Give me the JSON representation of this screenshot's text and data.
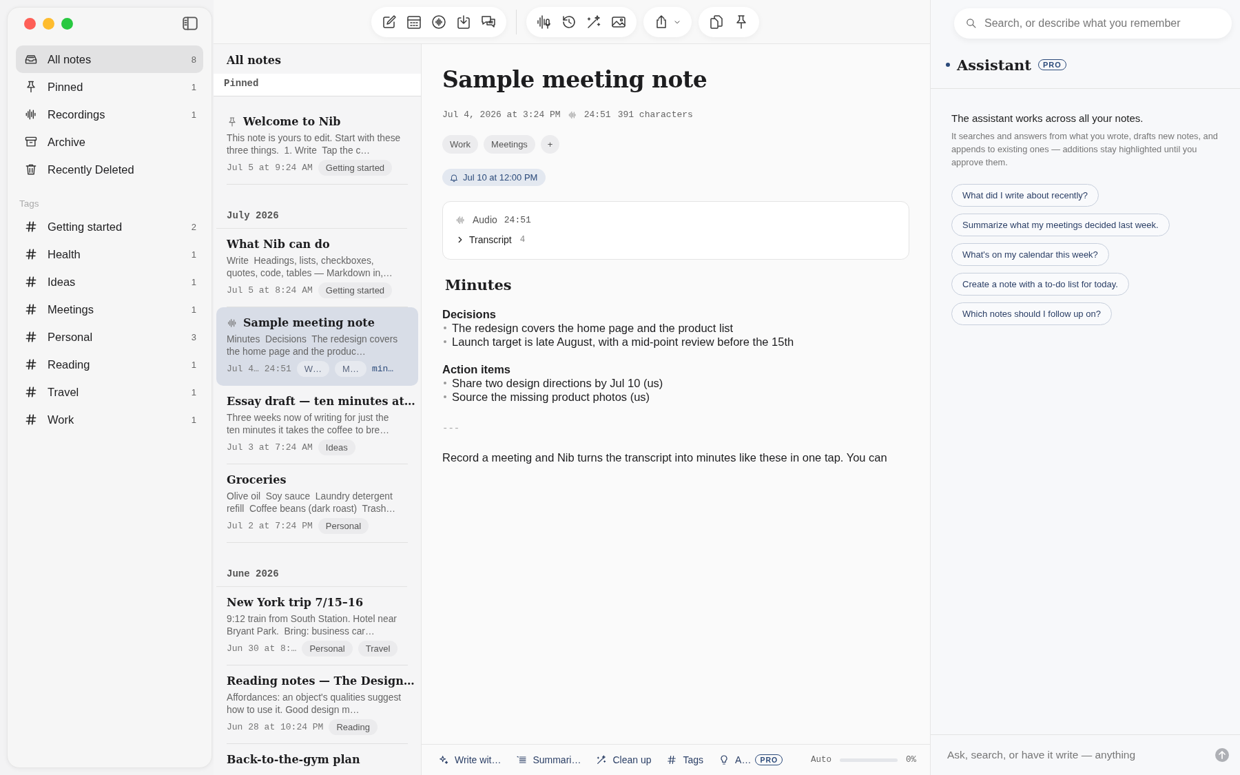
{
  "sidebar": {
    "items": [
      {
        "kind": "inbox",
        "label": "All notes",
        "count": "8",
        "selected": true
      },
      {
        "kind": "pin",
        "label": "Pinned",
        "count": "1",
        "selected": false
      },
      {
        "kind": "waveform",
        "label": "Recordings",
        "count": "1",
        "selected": false
      },
      {
        "kind": "archive",
        "label": "Archive",
        "selected": false
      },
      {
        "kind": "trash",
        "label": "Recently Deleted",
        "selected": false
      }
    ],
    "tags_heading": "Tags",
    "tags": [
      {
        "label": "Getting started",
        "count": "2",
        "selected": false
      },
      {
        "label": "Health",
        "count": "1",
        "selected": false
      },
      {
        "label": "Ideas",
        "count": "1",
        "selected": false
      },
      {
        "label": "Meetings",
        "count": "1",
        "selected": false
      },
      {
        "label": "Personal",
        "count": "3",
        "selected": false
      },
      {
        "label": "Reading",
        "count": "1",
        "selected": false
      },
      {
        "label": "Travel",
        "count": "1",
        "selected": false
      },
      {
        "label": "Work",
        "count": "1",
        "selected": false
      }
    ]
  },
  "note_list": {
    "title": "All notes",
    "sections": [
      {
        "heading": "Pinned",
        "notes": [
          {
            "kind": "pinned",
            "title": "Welcome to Nib",
            "preview": "This note is yours to edit. Start with these three things.  1. Write  Tap the c…",
            "date": "Jul 5 at 9:24 AM",
            "tags": [
              "Getting started"
            ],
            "selected": false
          }
        ]
      },
      {
        "heading": "July 2026",
        "notes": [
          {
            "kind": "plain",
            "title": "What Nib can do",
            "preview": "Write  Headings, lists, checkboxes, quotes, code, tables — Markdown in,…",
            "date": "Jul 5 at 8:24 AM",
            "tags": [
              "Getting started"
            ],
            "selected": false
          },
          {
            "kind": "recording",
            "title": "Sample meeting note",
            "preview": "Minutes  Decisions  The redesign covers the home page and the produc…",
            "date": "Jul 4…",
            "duration": "24:51",
            "tags": [
              "W…",
              "M…"
            ],
            "status": "min…",
            "selected": true
          },
          {
            "kind": "plain",
            "title": "Essay draft — ten minutes at…",
            "preview": "Three weeks now of writing for just the ten minutes it takes the coffee to bre…",
            "date": "Jul 3 at 7:24 AM",
            "tags": [
              "Ideas"
            ],
            "selected": false
          },
          {
            "kind": "plain",
            "title": "Groceries",
            "preview": "Olive oil  Soy sauce  Laundry detergent refill  Coffee beans (dark roast)  Trash…",
            "date": "Jul 2 at 7:24 PM",
            "tags": [
              "Personal"
            ],
            "selected": false
          }
        ]
      },
      {
        "heading": "June 2026",
        "notes": [
          {
            "kind": "plain",
            "title": "New York trip 7/15–16",
            "preview": "9:12 train from South Station. Hotel near Bryant Park.  Bring: business car…",
            "date": "Jun 30 at 8:…",
            "tags": [
              "Personal",
              "Travel"
            ],
            "selected": false
          },
          {
            "kind": "plain",
            "title": "Reading notes — The Design…",
            "preview": "Affordances: an object's qualities suggest how to use it. Good design m…",
            "date": "Jun 28 at 10:24 PM",
            "tags": [
              "Reading"
            ],
            "selected": false
          },
          {
            "kind": "plain",
            "title": "Back-to-the-gym plan",
            "selected": false
          }
        ]
      }
    ]
  },
  "editor": {
    "title": "Sample meeting note",
    "meta": {
      "date": "Jul 4, 2026 at 3:24 PM",
      "duration": "24:51",
      "characters": "391 characters"
    },
    "tags": [
      "Work",
      "Meetings"
    ],
    "add_tag": "+",
    "reminder": "Jul 10 at 12:00 PM",
    "audio": {
      "label": "Audio",
      "duration": "24:51",
      "transcript": {
        "label": "Transcript",
        "count": "4",
        "expanded": false
      }
    },
    "body": [
      {
        "kind": "heading",
        "text": "Minutes"
      },
      {
        "kind": "subheading",
        "text": "Decisions"
      },
      {
        "kind": "bullet",
        "text": "The redesign covers the home page and the product list"
      },
      {
        "kind": "bullet",
        "text": "Launch target is late August, with a mid-point review before the 15th"
      },
      {
        "kind": "subheading",
        "text": "Action items"
      },
      {
        "kind": "bullet",
        "text": "Share two design directions by Jul 10 (us)"
      },
      {
        "kind": "bullet",
        "text": "Source the missing product photos (us)"
      },
      {
        "kind": "rule",
        "text": "---"
      },
      {
        "kind": "paragraph",
        "text": "Record a meeting and Nib turns the transcript into minutes like these in one tap. You can"
      }
    ],
    "bottom_bar": {
      "actions": [
        {
          "kind": "sparkle",
          "label": "Write wit…"
        },
        {
          "kind": "list",
          "label": "Summari…"
        },
        {
          "kind": "wand",
          "label": "Clean up"
        },
        {
          "kind": "hash",
          "label": "Tags"
        },
        {
          "kind": "bulb",
          "label": "A…",
          "badge": "PRO"
        }
      ],
      "mode": "Auto",
      "meter": {
        "level": 0
      },
      "reading": "0%"
    }
  },
  "assistant": {
    "search": {
      "placeholder": "Search, or describe what you remember"
    },
    "title": "Assistant",
    "badge": "PRO",
    "intro": "The assistant works across all your notes.",
    "description": "It searches and answers from what you wrote, drafts new notes, and appends to existing ones — additions stay highlighted until you approve them.",
    "suggestions": [
      "What did I write about recently?",
      "Summarize what my meetings decided last week.",
      "What's on my calendar this week?",
      "Create a note with a to-do list for today.",
      "Which notes should I follow up on?"
    ],
    "input": {
      "placeholder": "Ask, search, or have it write — anything"
    }
  }
}
